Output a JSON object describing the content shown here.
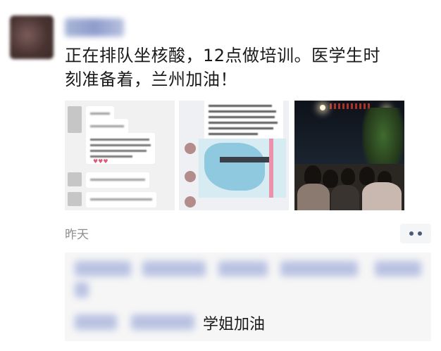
{
  "post": {
    "text_line1": "正在排队坐核酸，12点做培训。医学生时",
    "text_line2": "刻准备着，兰州加油！",
    "time": "昨天"
  },
  "comments": {
    "reply_text": "学姐加油"
  },
  "icons": {
    "more": "more-dots-icon"
  },
  "colors": {
    "text": "#1a1a1a",
    "time": "#8e8e8e",
    "comment_bg": "#f6f6f6",
    "name_blur": "#a9b5d8"
  }
}
